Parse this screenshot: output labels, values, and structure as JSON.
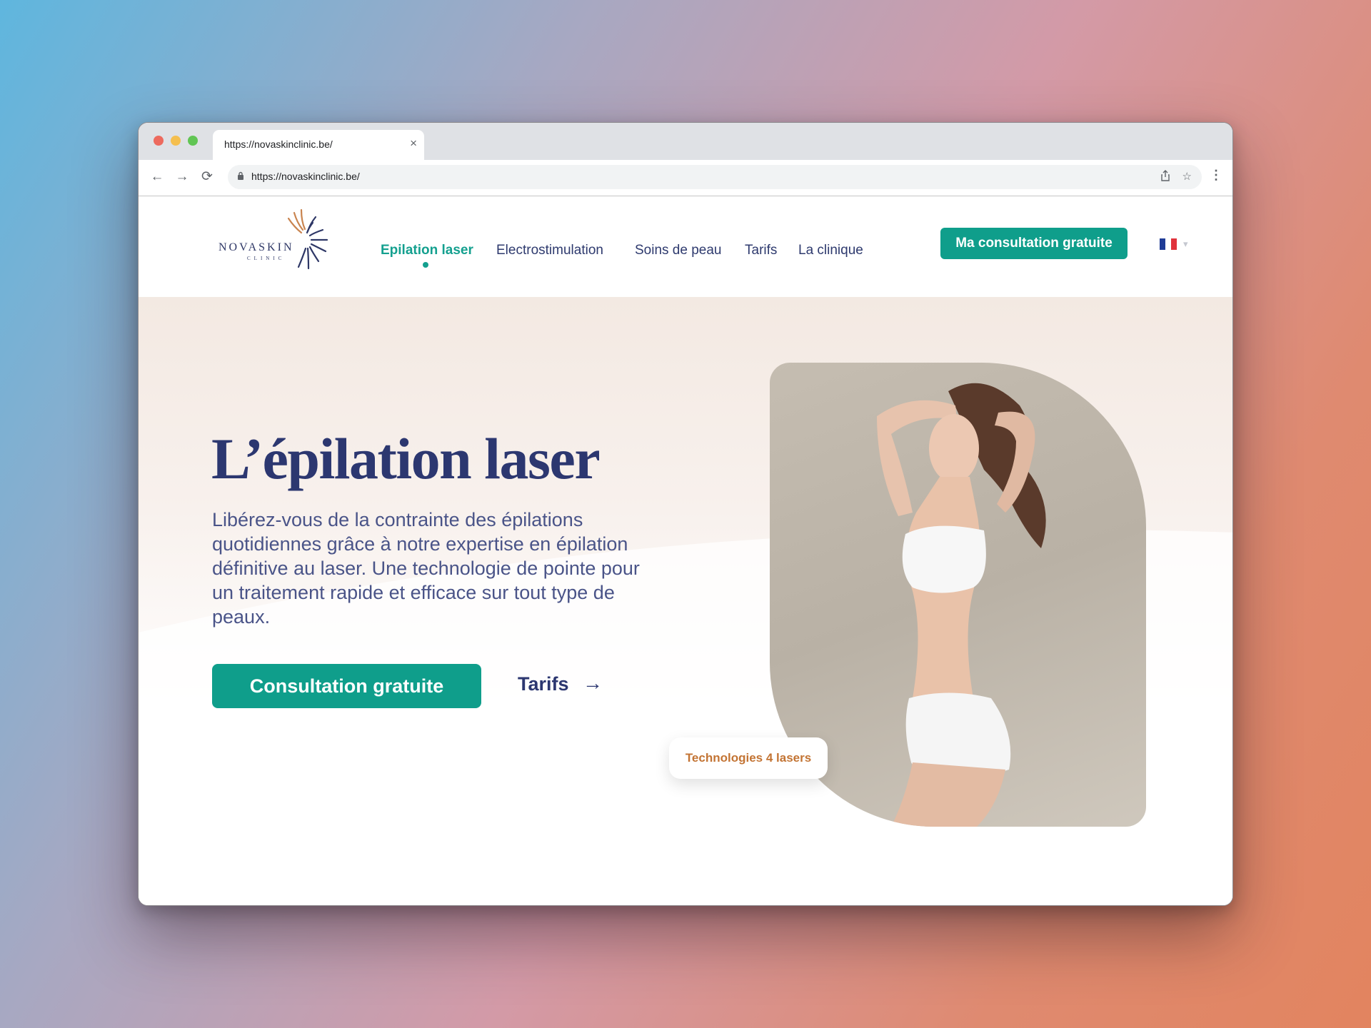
{
  "browser": {
    "tab_title": "https://novaskinclinic.be/",
    "tab_close": "×",
    "url": "https://novaskinclinic.be/",
    "back": "←",
    "forward": "→",
    "reload": "⟳",
    "lock": "🔒",
    "share": "⇪",
    "star": "☆",
    "menu": "⋮"
  },
  "site": {
    "logo": {
      "word": "NOVASKIN",
      "sub": "CLINIC"
    },
    "nav": [
      "Epilation laser",
      "Electrostimulation",
      "Soins de peau",
      "Tarifs",
      "La clinique"
    ],
    "active_nav": "Epilation laser",
    "header_cta": "Ma consultation gratuite",
    "language": "FR",
    "lang_caret": "▾",
    "hero": {
      "title": "L’épilation laser",
      "text": "Libérez-vous de la contrainte des épilations quotidiennes grâce à notre expertise en épilation définitive au laser. Une technologie de pointe pour un traitement rapide et efficace sur tout type de peaux.",
      "primary_cta": "Consultation gratuite",
      "secondary_link": "Tarifs",
      "secondary_arrow": "→",
      "badge": "Technologies 4 lasers"
    }
  },
  "colors": {
    "brand_teal": "#0f9e8b",
    "navy": "#2c3770",
    "badge_orange": "#c37434"
  },
  "icons": [
    "lock-icon",
    "share-icon",
    "star-icon",
    "menu-icon",
    "arrow-right-icon",
    "flag-fr-icon"
  ]
}
